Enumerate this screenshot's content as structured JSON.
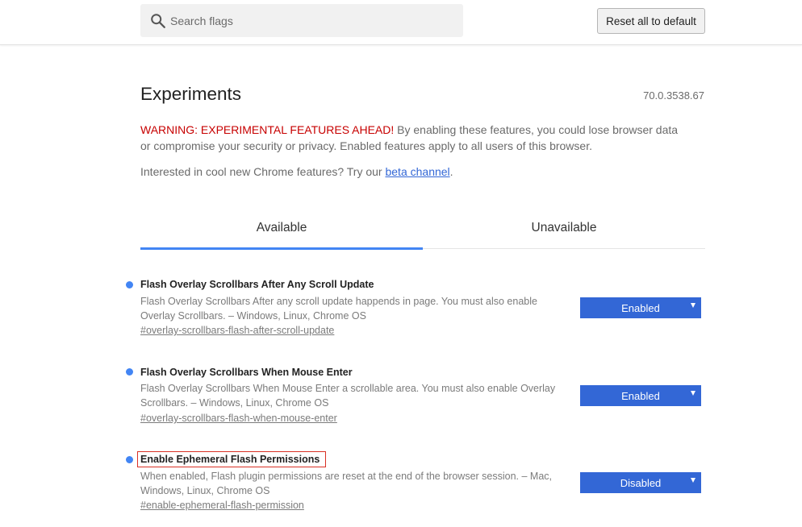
{
  "header": {
    "search_placeholder": "Search flags",
    "reset_label": "Reset all to default"
  },
  "page": {
    "title": "Experiments",
    "version": "70.0.3538.67",
    "warning_strong": "WARNING: EXPERIMENTAL FEATURES AHEAD!",
    "warning_text": " By enabling these features, you could lose browser data or compromise your security or privacy. Enabled features apply to all users of this browser.",
    "promo_text": "Interested in cool new Chrome features? Try our ",
    "promo_link": "beta channel",
    "promo_end": "."
  },
  "tabs": [
    {
      "label": "Available",
      "active": true
    },
    {
      "label": "Unavailable",
      "active": false
    }
  ],
  "experiments": [
    {
      "title": "Flash Overlay Scrollbars After Any Scroll Update",
      "description": "Flash Overlay Scrollbars After any scroll update happends in page. You must also enable Overlay Scrollbars. – Windows, Linux, Chrome OS",
      "link": "#overlay-scrollbars-flash-after-scroll-update",
      "value": "Enabled"
    },
    {
      "title": "Flash Overlay Scrollbars When Mouse Enter",
      "description": "Flash Overlay Scrollbars When Mouse Enter a scrollable area. You must also enable Overlay Scrollbars. – Windows, Linux, Chrome OS",
      "link": "#overlay-scrollbars-flash-when-mouse-enter",
      "value": "Enabled"
    },
    {
      "title": "Enable Ephemeral Flash Permissions",
      "description": "When enabled, Flash plugin permissions are reset at the end of the browser session. – Mac, Windows, Linux, Chrome OS",
      "link": "#enable-ephemeral-flash-permission",
      "value": "Disabled"
    }
  ],
  "colors": {
    "accent": "#4285f4",
    "select_bg": "#3367d6",
    "warning": "#c70000",
    "highlight_border": "#d93025"
  }
}
